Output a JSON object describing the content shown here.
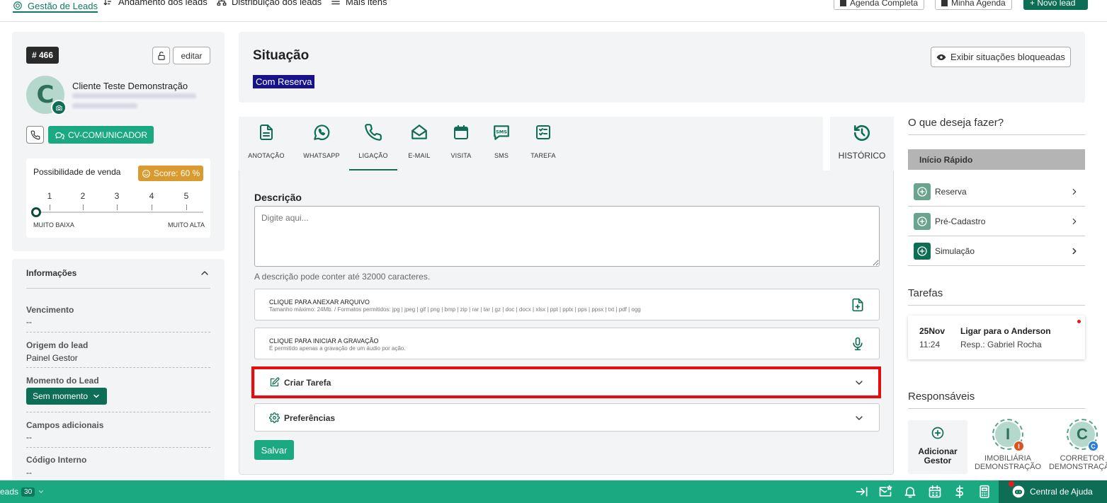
{
  "top_nav": {
    "tabs": [
      {
        "label": "Gestão de Leads",
        "icon": "target-icon"
      },
      {
        "label": "Andamento dos leads",
        "icon": "sort-icon"
      },
      {
        "label": "Distribuição dos leads",
        "icon": "sitemap-icon"
      },
      {
        "label": "Mais itens",
        "icon": "menu-icon"
      }
    ],
    "agenda_completa": "Agenda Completa",
    "minha_agenda": "Minha Agenda",
    "novo_lead": "+ Novo lead"
  },
  "lead": {
    "id": "# 466",
    "edit_label": "editar",
    "name": "Cliente Teste Demonstração",
    "avatar_letter": "C",
    "cv_button": "CV-COMUNICADOR",
    "sale_label": "Possibilidade de venda",
    "score": "Score: 60 %",
    "scale": [
      "1",
      "2",
      "3",
      "4",
      "5"
    ],
    "scale_min": "MUITO BAIXA",
    "scale_max": "MUITO ALTA",
    "selected_level": 0
  },
  "info": {
    "title": "Informações",
    "fields": [
      {
        "label": "Vencimento",
        "value": "--"
      },
      {
        "label": "Origem do lead",
        "value": "Painel Gestor"
      },
      {
        "label": "Momento do Lead",
        "value": "Sem momento"
      },
      {
        "label": "Campos adicionais",
        "value": "--"
      },
      {
        "label": "Código Interno",
        "value": "--"
      }
    ]
  },
  "situacao": {
    "title": "Situação",
    "badge": "Com Reserva",
    "exibir_button": "Exibir situações bloqueadas"
  },
  "action_tabs": [
    {
      "label": "ANOTAÇÃO",
      "icon": "document-icon"
    },
    {
      "label": "WHATSAPP",
      "icon": "whatsapp-icon"
    },
    {
      "label": "LIGAÇÃO",
      "icon": "phone-icon"
    },
    {
      "label": "E-MAIL",
      "icon": "envelope-icon"
    },
    {
      "label": "VISITA",
      "icon": "calendar-icon"
    },
    {
      "label": "SMS",
      "icon": "sms-icon"
    },
    {
      "label": "TAREFA",
      "icon": "checklist-icon"
    }
  ],
  "active_tab": "LIGAÇÃO",
  "historico_label": "HISTÓRICO",
  "form": {
    "description_label": "Descrição",
    "description_placeholder": "Digite aqui...",
    "description_hint": "A descrição pode conter até 32000 caracteres.",
    "attach_title": "CLIQUE PARA ANEXAR ARQUIVO",
    "attach_sub": "Tamanho máximo: 24Mb. / Formatos permitidos: jpg | jpeg | gif | png | bmp | zip | rar | tar | gz | doc | docx | xlsx | ppt | pptx | pps | ppsx | txt | pdf | ogg",
    "record_title": "CLIQUE PARA INICIAR A GRAVAÇÃO",
    "record_sub": "É permitido apenas a gravação de um áudio por ação.",
    "criar_tarefa": "Criar Tarefa",
    "preferencias": "Preferências",
    "save": "Salvar"
  },
  "sidebar": {
    "what_title": "O que deseja fazer?",
    "quick_start": "Início Rápido",
    "quick_items": [
      {
        "label": "Reserva"
      },
      {
        "label": "Pré-Cadastro"
      },
      {
        "label": "Simulação"
      }
    ],
    "tasks_title": "Tarefas",
    "task": {
      "date": "25Nov",
      "time": "11:24",
      "title": "Ligar para o Anderson",
      "resp": "Resp.: Gabriel Rocha"
    },
    "resp_title": "Responsáveis",
    "add_gestor": "Adicionar Gestor",
    "responsaveis": [
      {
        "letter": "I",
        "badge": "I",
        "badge_color": "#d9531e",
        "label_line1": "IMOBILIÁRIA",
        "label_line2": "DEMONSTRAÇÃO"
      },
      {
        "letter": "C",
        "badge": "C",
        "badge_color": "#2a7fd4",
        "label_line1": "CORRETOR",
        "label_line2": "DEMONSTRAÇÃO"
      }
    ]
  },
  "bottom_bar": {
    "leads_label": "eads",
    "leads_count": "30",
    "help": "Central de Ajuda"
  },
  "colors": {
    "brand": "#0d6e55",
    "accent": "#1aa980",
    "badge": "#17128c",
    "score": "#d99b2f",
    "highlight": "#e80d0d"
  }
}
